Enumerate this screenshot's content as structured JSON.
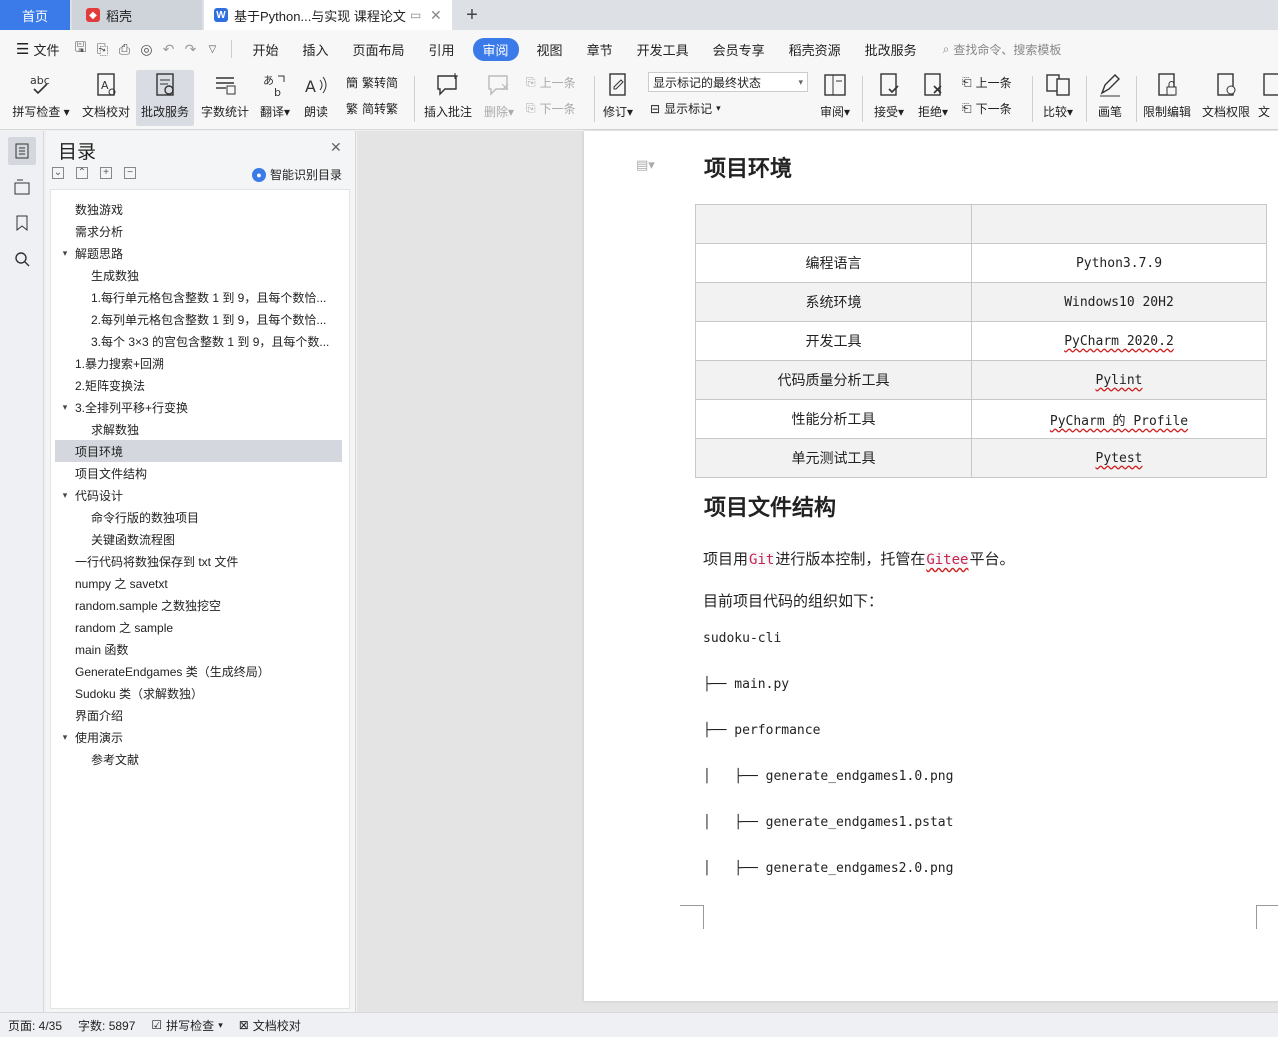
{
  "tabs": {
    "home": "首页",
    "daoke": "稻壳",
    "doc": "基于Python...与实现 课程论文",
    "add": "+"
  },
  "menu": {
    "file": "文件",
    "items": [
      "开始",
      "插入",
      "页面布局",
      "引用",
      "审阅",
      "视图",
      "章节",
      "开发工具",
      "会员专享",
      "稻壳资源",
      "批改服务"
    ],
    "active_index": 4,
    "search": "查找命令、搜索模板"
  },
  "ribbon": {
    "spellcheck": "拼写检查",
    "doc_proof": "文档校对",
    "grading": "批改服务",
    "word_count": "字数统计",
    "translate": "翻译",
    "read_aloud": "朗读",
    "trad_to_simp": "繁转简",
    "simp_to_trad": "简转繁",
    "insert_comment": "插入批注",
    "delete": "删除",
    "prev_comment": "上一条",
    "next_comment": "下一条",
    "track": "修订",
    "markup_state": "显示标记的最终状态",
    "show_markup": "显示标记",
    "review": "审阅",
    "accept": "接受",
    "reject": "拒绝",
    "prev_change": "上一条",
    "next_change": "下一条",
    "compare": "比较",
    "pen": "画笔",
    "restrict_edit": "限制编辑",
    "doc_permission": "文档权限",
    "doc_cut": "文"
  },
  "toc": {
    "title": "目录",
    "smart": "智能识别目录",
    "items": [
      {
        "text": "数独游戏",
        "level": 1,
        "caret": false,
        "selected": false
      },
      {
        "text": "需求分析",
        "level": 1,
        "caret": false,
        "selected": false
      },
      {
        "text": "解题思路",
        "level": 1,
        "caret": true,
        "selected": false
      },
      {
        "text": "生成数独",
        "level": 2,
        "caret": false,
        "selected": false
      },
      {
        "text": "1.每行单元格包含整数 1 到 9，且每个数恰...",
        "level": 2,
        "caret": false,
        "selected": false
      },
      {
        "text": "2.每列单元格包含整数 1 到 9，且每个数恰...",
        "level": 2,
        "caret": false,
        "selected": false
      },
      {
        "text": "3.每个 3×3 的宫包含整数 1 到 9，且每个数...",
        "level": 2,
        "caret": false,
        "selected": false
      },
      {
        "text": "1.暴力搜索+回溯",
        "level": 1,
        "caret": false,
        "selected": false
      },
      {
        "text": "2.矩阵变换法",
        "level": 1,
        "caret": false,
        "selected": false
      },
      {
        "text": "3.全排列平移+行变换",
        "level": 1,
        "caret": true,
        "selected": false
      },
      {
        "text": "求解数独",
        "level": 2,
        "caret": false,
        "selected": false
      },
      {
        "text": "项目环境",
        "level": 1,
        "caret": false,
        "selected": true
      },
      {
        "text": "项目文件结构",
        "level": 1,
        "caret": false,
        "selected": false
      },
      {
        "text": "代码设计",
        "level": 1,
        "caret": true,
        "selected": false
      },
      {
        "text": "命令行版的数独项目",
        "level": 2,
        "caret": false,
        "selected": false
      },
      {
        "text": "关键函数流程图",
        "level": 2,
        "caret": false,
        "selected": false
      },
      {
        "text": "一行代码将数独保存到 txt 文件",
        "level": 1,
        "caret": false,
        "selected": false
      },
      {
        "text": "numpy 之 savetxt",
        "level": 1,
        "caret": false,
        "selected": false
      },
      {
        "text": "random.sample 之数独挖空",
        "level": 1,
        "caret": false,
        "selected": false
      },
      {
        "text": "random 之 sample",
        "level": 1,
        "caret": false,
        "selected": false
      },
      {
        "text": "main 函数",
        "level": 1,
        "caret": false,
        "selected": false
      },
      {
        "text": "GenerateEndgames 类（生成终局）",
        "level": 1,
        "caret": false,
        "selected": false
      },
      {
        "text": "Sudoku 类（求解数独）",
        "level": 1,
        "caret": false,
        "selected": false
      },
      {
        "text": "界面介绍",
        "level": 1,
        "caret": false,
        "selected": false
      },
      {
        "text": "使用演示",
        "level": 1,
        "caret": true,
        "selected": false
      },
      {
        "text": "参考文献",
        "level": 2,
        "caret": false,
        "selected": false
      }
    ]
  },
  "doc": {
    "heading_env": "项目环境",
    "env_table": [
      [
        "",
        ""
      ],
      [
        "编程语言",
        "Python3.7.9"
      ],
      [
        "系统环境",
        "Windows10 20H2"
      ],
      [
        "开发工具",
        "PyCharm 2020.2"
      ],
      [
        "代码质量分析工具",
        "Pylint"
      ],
      [
        "性能分析工具",
        "PyCharm 的 Profile"
      ],
      [
        "单元测试工具",
        "Pytest"
      ]
    ],
    "heading_struct": "项目文件结构",
    "para1_a": "项目用",
    "para1_git": "Git",
    "para1_b": "进行版本控制，托管在",
    "para1_gitee": "Gitee",
    "para1_c": "平台。",
    "para2": "目前项目代码的组织如下：",
    "tree": [
      "sudoku-cli",
      "├── main.py",
      "├── performance",
      "│   ├── generate_endgames1.0.png",
      "│   ├── generate_endgames1.pstat",
      "│   ├── generate_endgames2.0.png"
    ]
  },
  "status": {
    "page": "页面: 4/35",
    "words": "字数: 5897",
    "spell": "拼写检查",
    "proof": "文档校对"
  },
  "colors": {
    "accent": "#3b7be9",
    "code_red": "#c7254e"
  }
}
